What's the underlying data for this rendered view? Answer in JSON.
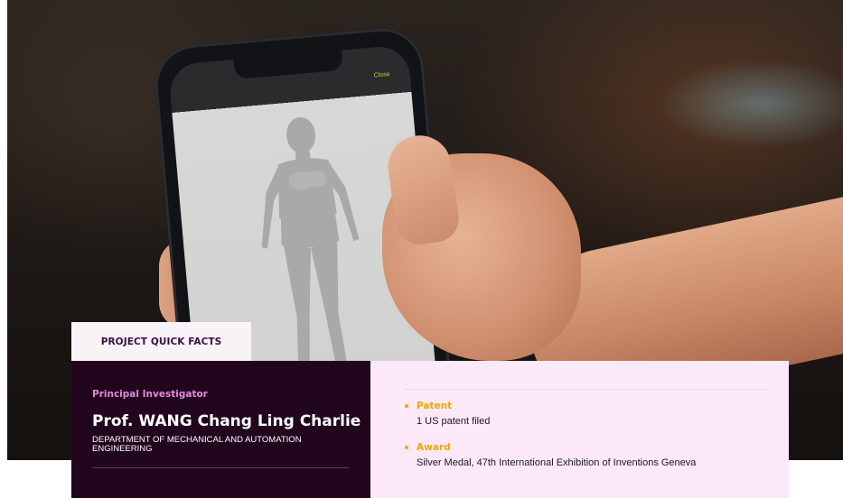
{
  "hero": {
    "phone_close_label": "Close"
  },
  "quick_facts": {
    "tab_label": "PROJECT QUICK FACTS",
    "principal_investigator": {
      "label": "Principal Investigator",
      "name": "Prof. WANG Chang Ling Charlie",
      "department": "DEPARTMENT OF MECHANICAL AND AUTOMATION ENGINEERING"
    },
    "facts": [
      {
        "title": "Patent",
        "body": "1 US patent filed"
      },
      {
        "title": "Award",
        "body": "Silver Medal, 47th International Exhibition of Inventions Geneva"
      }
    ]
  },
  "colors": {
    "dark_panel": "#22061e",
    "light_panel": "#fbe8f9",
    "accent_pink": "#e08ad9",
    "accent_gold": "#f0a800",
    "tab_text": "#3b0f42"
  }
}
